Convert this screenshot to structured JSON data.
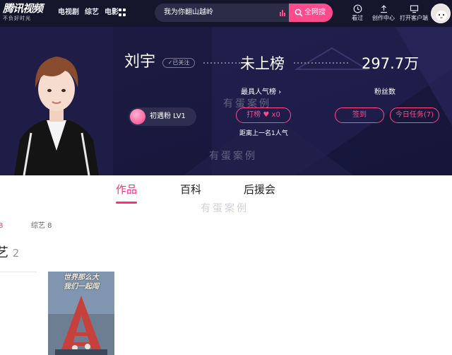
{
  "logo": {
    "main": "腾讯视频",
    "sub": "不负好时光"
  },
  "nav": {
    "links": [
      "电视剧",
      "综艺",
      "电影"
    ]
  },
  "search": {
    "query": "我为你翻山越岭",
    "button": "全网搜"
  },
  "tools": [
    {
      "label": "看过",
      "icon": "clock-icon"
    },
    {
      "label": "创作中心",
      "icon": "upload-icon"
    },
    {
      "label": "打开客户端",
      "icon": "client-icon"
    }
  ],
  "star": {
    "name": "刘宇",
    "follow_status": "✓已关注",
    "rank_value": "未上榜",
    "rank_link": "最具人气榜 ›",
    "fans_value": "297.7万",
    "fans_label": "粉丝数",
    "level_text": "初遇粉 LV1",
    "vote_label": "打榜",
    "vote_count": "x0",
    "gap_text": "距离上一名1人气",
    "signin_label": "签到",
    "task_label": "今日任务(7)"
  },
  "watermark": "有蛋案例",
  "tabs": [
    {
      "label": "作品",
      "active": true
    },
    {
      "label": "百科",
      "active": false
    },
    {
      "label": "后援会",
      "active": false
    }
  ],
  "filters": {
    "first": "8",
    "second": "综艺 8"
  },
  "section": {
    "title": "艺",
    "count": "2"
  },
  "poster": {
    "line1": "世界那么大",
    "line2": "我们一起闯"
  },
  "colors": {
    "accent": "#ff2d7a",
    "nav_bg": "#15152b",
    "banner_bg": "#1c1a40"
  }
}
